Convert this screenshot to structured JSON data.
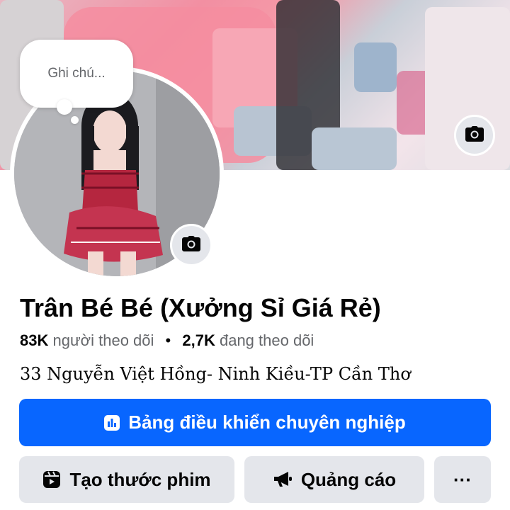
{
  "note": {
    "placeholder": "Ghi chú..."
  },
  "profile": {
    "name": "Trân Bé Bé (Xưởng Sỉ Giá Rẻ)",
    "followers_count": "83K",
    "followers_label": "người theo dõi",
    "separator": "•",
    "following_count": "2,7K",
    "following_label": "đang theo dõi",
    "address": "33 Nguyễn Việt Hồng- Ninh Kiều-TP Cần Thơ"
  },
  "buttons": {
    "dashboard": "Bảng điều khiển chuyên nghiệp",
    "create_reel": "Tạo thước phim",
    "ads": "Quảng cáo",
    "more": "···"
  },
  "icons": {
    "cover_camera": "camera-icon",
    "avatar_camera": "camera-icon",
    "dashboard": "chart-icon",
    "reel": "reel-icon",
    "ads": "megaphone-icon",
    "more": "more-icon"
  },
  "colors": {
    "primary": "#0866ff",
    "secondary_bg": "#e4e6eb",
    "muted_text": "#65676b"
  }
}
